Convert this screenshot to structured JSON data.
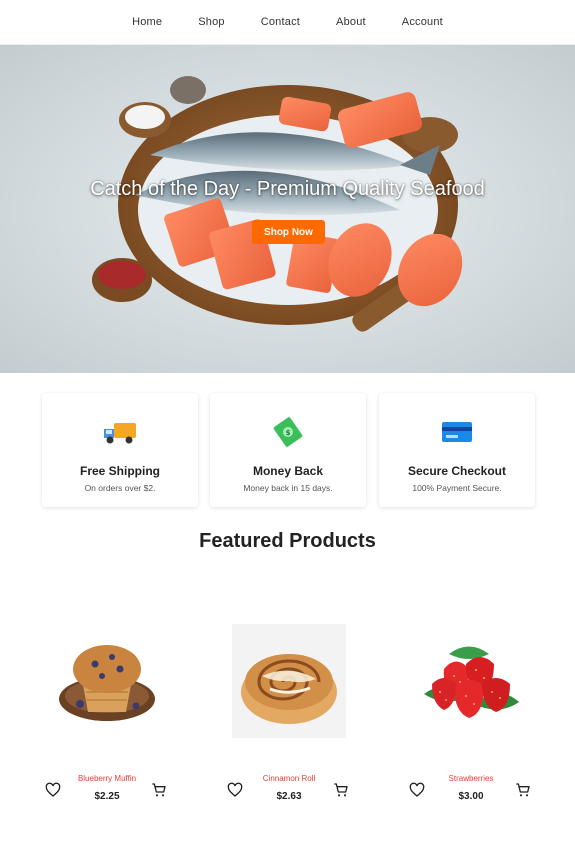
{
  "nav": {
    "items": [
      {
        "label": "Home"
      },
      {
        "label": "Shop"
      },
      {
        "label": "Contact"
      },
      {
        "label": "About"
      },
      {
        "label": "Account"
      }
    ]
  },
  "hero": {
    "title": "Catch of the Day - Premium Quality Seafood",
    "button_label": "Shop Now",
    "accent_color": "#ff6a00"
  },
  "features": [
    {
      "title": "Free Shipping",
      "subtitle": "On orders over $2.",
      "icon": "delivery-truck-icon"
    },
    {
      "title": "Money Back",
      "subtitle": "Money back in 15 days.",
      "icon": "money-icon"
    },
    {
      "title": "Secure Checkout",
      "subtitle": "100% Payment Secure.",
      "icon": "credit-card-icon"
    }
  ],
  "featured": {
    "title": "Featured Products"
  },
  "products": [
    {
      "name": "Blueberry Muffin",
      "price": "$2.25"
    },
    {
      "name": "Cinnamon Roll",
      "price": "$2.63"
    },
    {
      "name": "Strawberries",
      "price": "$3.00"
    }
  ],
  "colors": {
    "product_name": "#e8413a",
    "text": "#222222"
  }
}
